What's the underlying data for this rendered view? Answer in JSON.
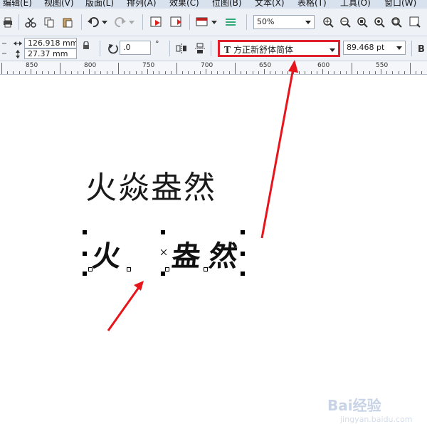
{
  "menubar": {
    "items": [
      "编辑(E)",
      "视图(V)",
      "版面(L)",
      "排列(A)",
      "效果(C)",
      "位图(B)",
      "文本(X)",
      "表格(T)",
      "工具(O)",
      "窗口(W)"
    ]
  },
  "toolbar": {
    "zoom": "50%"
  },
  "properties": {
    "width": "126.918 mm",
    "height": "27.37 mm",
    "rotation": ".0",
    "degree_symbol": "°",
    "font_icon_label": "T",
    "font_name": "方正新舒体简体",
    "font_size": "89.468 pt"
  },
  "ruler": {
    "labels": [
      "850",
      "800",
      "750",
      "700",
      "650",
      "600",
      "550"
    ]
  },
  "canvas": {
    "text_line": "火焱盎然",
    "selected_chars": [
      "火",
      "盎",
      "然"
    ]
  },
  "watermark": {
    "text": "Bai经验",
    "url": "jingyan.baidu.com"
  },
  "colors": {
    "highlight_box": "#e0202a",
    "arrow": "#e8141c",
    "toolbar_bg": "#eef2f7"
  }
}
